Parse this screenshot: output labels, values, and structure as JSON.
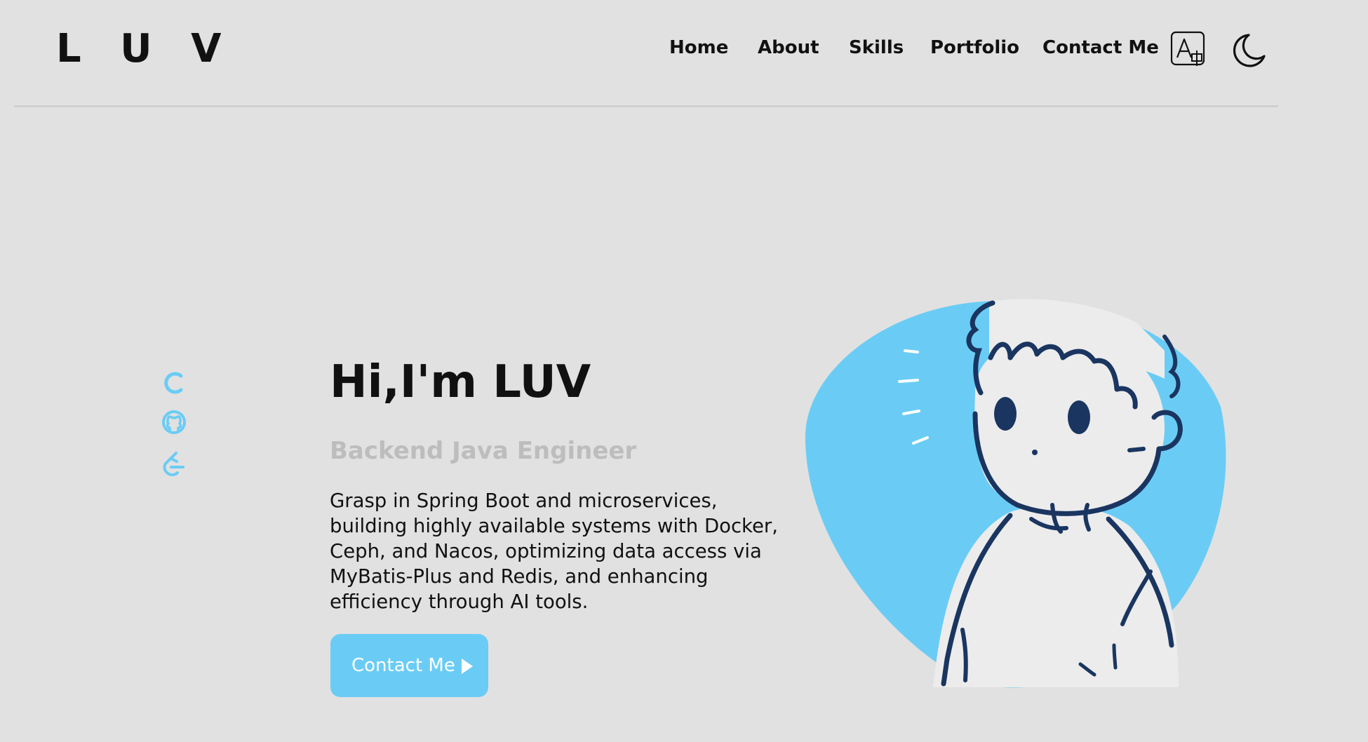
{
  "header": {
    "logo": "L U V",
    "nav": {
      "home": "Home",
      "about": "About",
      "skills": "Skills",
      "portfolio": "Portfolio",
      "contact": "Contact Me"
    },
    "icons": {
      "translate": "translate-icon",
      "theme": "moon-icon"
    }
  },
  "social": {
    "icons": [
      "csdn-icon",
      "github-icon",
      "leetcode-icon"
    ]
  },
  "hero": {
    "title": "Hi,I'm LUV",
    "subtitle": "Backend Java Engineer",
    "description": "Grasp in Spring Boot and microservices, building highly available systems with Docker, Ceph, and Nacos, optimizing data access via MyBatis-Plus and Redis, and enhancing efficiency through AI tools.",
    "cta_label": "Contact Me"
  },
  "colors": {
    "background": "#e1e1e1",
    "accent": "#6accf5",
    "text": "#111111",
    "subtitle": "#bdbdbd",
    "outline": "#1a3560"
  }
}
